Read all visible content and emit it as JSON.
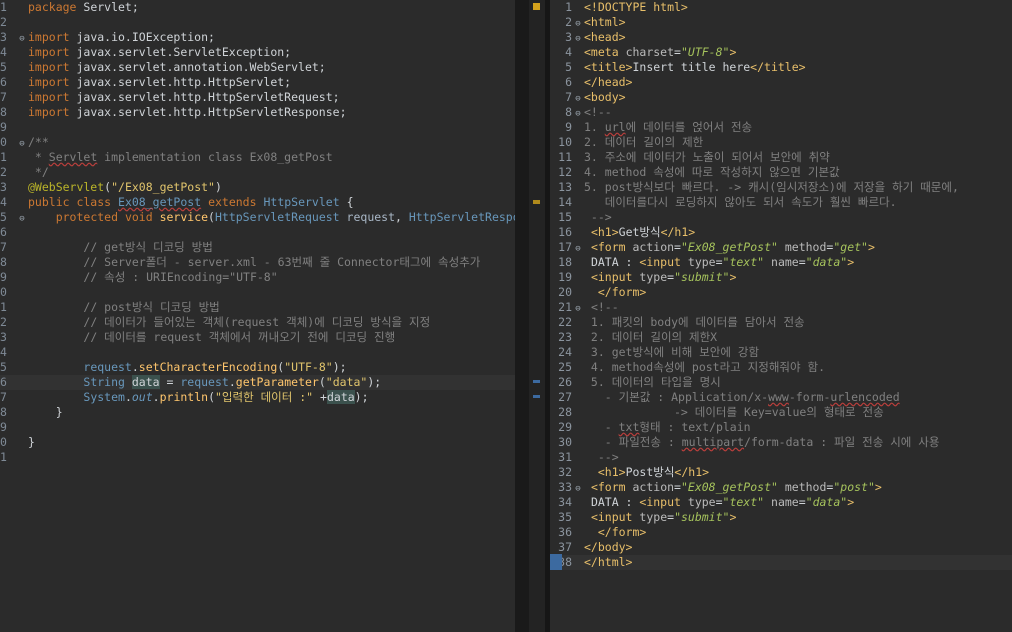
{
  "left_editor": {
    "lines": [
      {
        "n": "1",
        "fold": "",
        "html": "<span class='kw'>package</span> Servlet;"
      },
      {
        "n": "2",
        "fold": "",
        "html": ""
      },
      {
        "n": "3",
        "fold": "⊖",
        "html": "<span class='kw'>import</span> java.io.IOException;"
      },
      {
        "n": "4",
        "fold": "",
        "html": "<span class='kw'>import</span> javax.servlet.ServletException;"
      },
      {
        "n": "5",
        "fold": "",
        "html": "<span class='kw'>import</span> javax.servlet.annotation.WebServlet;"
      },
      {
        "n": "6",
        "fold": "",
        "html": "<span class='kw'>import</span> javax.servlet.http.HttpServlet;"
      },
      {
        "n": "7",
        "fold": "",
        "html": "<span class='kw'>import</span> javax.servlet.http.HttpServletRequest;"
      },
      {
        "n": "8",
        "fold": "",
        "html": "<span class='kw'>import</span> javax.servlet.http.HttpServletResponse;"
      },
      {
        "n": "9",
        "fold": "",
        "html": ""
      },
      {
        "n": "0",
        "fold": "⊖",
        "html": "<span class='cm'>/**</span>"
      },
      {
        "n": "1",
        "fold": "",
        "html": "<span class='cm'> * <span class='err'>Servlet</span> implementation class Ex08_getPost</span>"
      },
      {
        "n": "2",
        "fold": "",
        "html": "<span class='cm'> */</span>"
      },
      {
        "n": "3",
        "fold": "",
        "html": "<span class='an'>@WebServlet</span><span class='pl'>(</span><span class='st'>\"/Ex08_getPost\"</span><span class='pl'>)</span>"
      },
      {
        "n": "4",
        "fold": "",
        "html": "<span class='kw'>public class</span> <span class='ty err'>Ex08_getPost</span> <span class='kw'>extends</span> <span class='ty'>HttpServlet</span> {"
      },
      {
        "n": "5",
        "fold": "⊖",
        "html": "    <span class='kw'>protected void</span> <span class='fn'>service</span>(<span class='ty'>HttpServletRequest</span> <span class='pm'>request</span>, <span class='ty'>HttpServletRespo</span>"
      },
      {
        "n": "6",
        "fold": "",
        "html": ""
      },
      {
        "n": "7",
        "fold": "",
        "html": "        <span class='cm'>// get방식 디코딩 방법</span>"
      },
      {
        "n": "8",
        "fold": "",
        "html": "        <span class='cm'>// Server폴더 - server.xml - 63번째 줄 Connector태그에 속성추가</span>"
      },
      {
        "n": "9",
        "fold": "",
        "html": "        <span class='cm'>// 속성 : URIEncoding=\"UTF-8\"</span>"
      },
      {
        "n": "0",
        "fold": "",
        "html": ""
      },
      {
        "n": "1",
        "fold": "",
        "html": "        <span class='cm'>// post방식 디코딩 방법</span>"
      },
      {
        "n": "2",
        "fold": "",
        "html": "        <span class='cm'>// 데이터가 들어있는 객체(request 객체)에 디코딩 방식을 지정</span>"
      },
      {
        "n": "3",
        "fold": "",
        "html": "        <span class='cm'>// 데이터를 request 객체에서 꺼내오기 전에 디코딩 진행</span>"
      },
      {
        "n": "4",
        "fold": "",
        "html": ""
      },
      {
        "n": "5",
        "fold": "",
        "html": "        <span class='ty'>request</span>.<span class='fn'>setCharacterEncoding</span>(<span class='st'>\"UTF-8\"</span>);"
      },
      {
        "n": "6",
        "fold": "",
        "cur": true,
        "html": "        <span class='ty'>String</span> <span class='hl'>data</span> = <span class='ty'>request</span>.<span class='fn'>getParameter</span>(<span class='st'>\"data\"</span>);"
      },
      {
        "n": "7",
        "fold": "",
        "html": "        <span class='ty'>System</span>.<span class='ty it'>out</span>.<span class='fn'>println</span>(<span class='st'>\"입력한 데이터 :\"</span> +<span class='hl'>data</span>);"
      },
      {
        "n": "8",
        "fold": "",
        "html": "    }"
      },
      {
        "n": "9",
        "fold": "",
        "html": ""
      },
      {
        "n": "0",
        "fold": "",
        "html": "}"
      },
      {
        "n": "1",
        "fold": "",
        "html": ""
      }
    ]
  },
  "right_editor": {
    "lines": [
      {
        "n": "1",
        "fold": "",
        "html": "<span class='tag'>&lt;!DOCTYPE html&gt;</span>"
      },
      {
        "n": "2",
        "fold": "⊖",
        "html": "<span class='tag'>&lt;html&gt;</span>"
      },
      {
        "n": "3",
        "fold": "⊖",
        "html": "<span class='tag'>&lt;head&gt;</span>"
      },
      {
        "n": "4",
        "fold": "",
        "html": "<span class='tag'>&lt;meta</span> <span class='attr'>charset</span>=<span class='attrv'>\"UTF-8\"</span><span class='tag'>&gt;</span>"
      },
      {
        "n": "5",
        "fold": "",
        "html": "<span class='tag'>&lt;title&gt;</span><span class='pl'>Insert title here</span><span class='tag'>&lt;/title&gt;</span>"
      },
      {
        "n": "6",
        "fold": "",
        "html": "<span class='tag'>&lt;/head&gt;</span>"
      },
      {
        "n": "7",
        "fold": "⊖",
        "html": "<span class='tag'>&lt;body&gt;</span>"
      },
      {
        "n": "8",
        "fold": "⊖",
        "html": "<span class='cm'>&lt;!--</span>"
      },
      {
        "n": "9",
        "fold": "",
        "html": "<span class='cm'>1. <span class='err'>url</span>에 데이터를 얹어서 전송</span>"
      },
      {
        "n": "10",
        "fold": "",
        "html": "<span class='cm'>2. 데이터 길이의 제한</span>"
      },
      {
        "n": "11",
        "fold": "",
        "html": "<span class='cm'>3. 주소에 데이터가 노출이 되어서 보안에 취약</span>"
      },
      {
        "n": "12",
        "fold": "",
        "html": "<span class='cm'>4. method 속성에 따로 작성하지 않으면 기본값</span>"
      },
      {
        "n": "13",
        "fold": "",
        "html": "<span class='cm'>5. post방식보다 빠르다. -&gt; 캐시(임시저장소)에 저장을 하기 때문에,</span>"
      },
      {
        "n": "14",
        "fold": "",
        "html": "<span class='cm'>   데이터를다시 로딩하지 않아도 되서 속도가 훨씬 빠르다.</span>"
      },
      {
        "n": "15",
        "fold": "",
        "html": "<span class='cm'> --&gt;</span>"
      },
      {
        "n": "16",
        "fold": "",
        "html": " <span class='tag'>&lt;h1&gt;</span><span class='pl'>Get방식</span><span class='tag'>&lt;/h1&gt;</span>"
      },
      {
        "n": "17",
        "fold": "⊖",
        "html": " <span class='tag'>&lt;form</span> <span class='attr'>action</span>=<span class='attrv'>\"Ex08_getPost\"</span> <span class='attr'>method</span>=<span class='attrv'>\"get\"</span><span class='tag'>&gt;</span>"
      },
      {
        "n": "18",
        "fold": "",
        "html": " <span class='pl'>DATA : </span><span class='tag'>&lt;input</span> <span class='attr'>type</span>=<span class='attrv'>\"text\"</span> <span class='attr'>name</span>=<span class='attrv'>\"data\"</span><span class='tag'>&gt;</span>"
      },
      {
        "n": "19",
        "fold": "",
        "html": " <span class='tag'>&lt;input</span> <span class='attr'>type</span>=<span class='attrv'>\"submit\"</span><span class='tag'>&gt;</span>"
      },
      {
        "n": "20",
        "fold": "",
        "html": "  <span class='tag'>&lt;/form&gt;</span>"
      },
      {
        "n": "21",
        "fold": "⊖",
        "html": " <span class='cm'>&lt;!--</span>"
      },
      {
        "n": "22",
        "fold": "",
        "html": "<span class='cm'> 1. 패킷의 body에 데이터를 담아서 전송</span>"
      },
      {
        "n": "23",
        "fold": "",
        "html": "<span class='cm'> 2. 데이터 길이의 제한X</span>"
      },
      {
        "n": "24",
        "fold": "",
        "html": "<span class='cm'> 3. get방식에 비해 보안에 강함</span>"
      },
      {
        "n": "25",
        "fold": "",
        "html": "<span class='cm'> 4. method속성에 post라고 지정해줘야 함.</span>"
      },
      {
        "n": "26",
        "fold": "",
        "html": "<span class='cm'> 5. 데이터의 타입을 명시</span>"
      },
      {
        "n": "27",
        "fold": "",
        "html": "<span class='cm'>   - 기본값 : Application/x-<span class='err'>www</span>-form-<span class='err'>urlencoded</span></span>"
      },
      {
        "n": "28",
        "fold": "",
        "html": "<span class='cm'>             -&gt; 데이터를 Key=value의 형태로 전송</span>"
      },
      {
        "n": "29",
        "fold": "",
        "html": "<span class='cm'>   - <span class='err'>txt</span>형태 : text/plain</span>"
      },
      {
        "n": "30",
        "fold": "",
        "html": "<span class='cm'>   - 파일전송 : <span class='err'>multipart</span>/form-data : 파일 전송 시에 사용</span>"
      },
      {
        "n": "31",
        "fold": "",
        "html": "<span class='cm'>  --&gt;</span>"
      },
      {
        "n": "32",
        "fold": "",
        "html": "  <span class='tag'>&lt;h1&gt;</span><span class='pl'>Post방식</span><span class='tag'>&lt;/h1&gt;</span>"
      },
      {
        "n": "33",
        "fold": "⊖",
        "html": " <span class='tag'>&lt;form</span> <span class='attr'>action</span>=<span class='attrv'>\"Ex08_getPost\"</span> <span class='attr'>method</span>=<span class='attrv'>\"post\"</span><span class='tag'>&gt;</span>"
      },
      {
        "n": "34",
        "fold": "",
        "html": " <span class='pl'>DATA : </span><span class='tag'>&lt;input</span> <span class='attr'>type</span>=<span class='attrv'>\"text\"</span> <span class='attr'>name</span>=<span class='attrv'>\"data\"</span><span class='tag'>&gt;</span>"
      },
      {
        "n": "35",
        "fold": "",
        "html": " <span class='tag'>&lt;input</span> <span class='attr'>type</span>=<span class='attrv'>\"submit\"</span><span class='tag'>&gt;</span>"
      },
      {
        "n": "36",
        "fold": "",
        "html": "  <span class='tag'>&lt;/form&gt;</span>"
      },
      {
        "n": "37",
        "fold": "",
        "html": "<span class='tag'>&lt;/body&gt;</span>"
      },
      {
        "n": "38",
        "fold": "",
        "cur": true,
        "html": "<span class='tag'>&lt;/html&gt;</span>"
      }
    ]
  },
  "colors": {
    "editor_bg": "#2b2b2b",
    "warning": "#d4a21c",
    "marker": "#3c6aa0"
  },
  "icons": {
    "scroll_up": "▲"
  }
}
